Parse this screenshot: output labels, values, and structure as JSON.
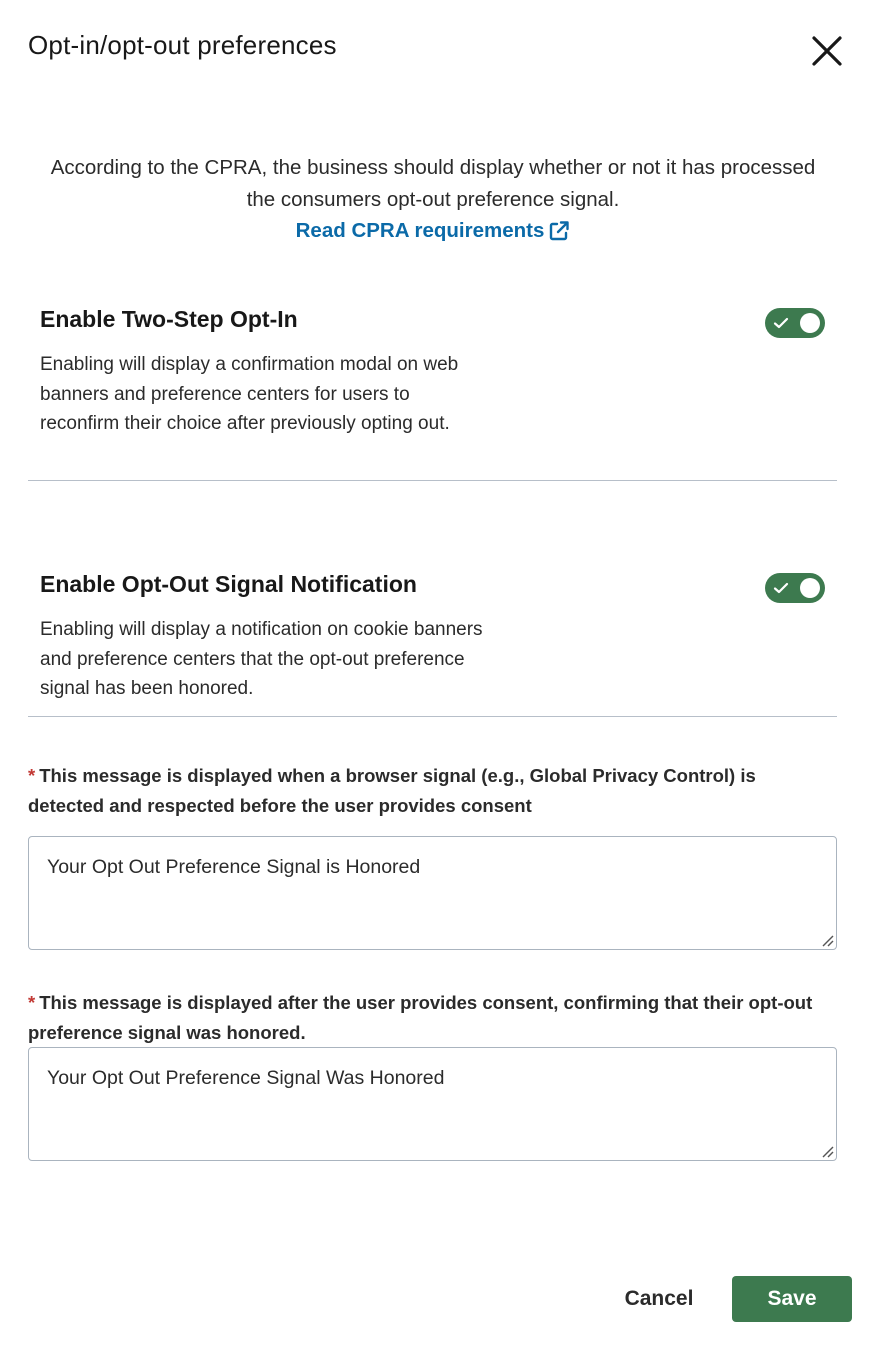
{
  "modal": {
    "title": "Opt-in/opt-out preferences",
    "close_icon": "close-icon"
  },
  "intro": {
    "text": "According to the CPRA, the business should display whether or not it has processed the consumers opt-out preference signal.",
    "link_label": "Read CPRA requirements",
    "link_icon": "external-link-icon",
    "link_color": "#0b6aa8"
  },
  "sections": [
    {
      "title": "Enable Two-Step Opt-In",
      "description": "Enabling will display a confirmation modal on web banners and preference centers for users to reconfirm their choice after previously opting out.",
      "enabled": true
    },
    {
      "title": "Enable Opt-Out Signal Notification",
      "description": "Enabling will display a notification on cookie banners and preference centers that the opt-out preference signal has been honored.",
      "enabled": true
    }
  ],
  "fields": [
    {
      "required_marker": "*",
      "label": "This message is displayed when a browser signal (e.g., Global Privacy Control) is detected and respected before the user provides consent",
      "value": "Your Opt Out Preference Signal is Honored"
    },
    {
      "required_marker": "*",
      "label": "This message is displayed after the user provides consent, confirming that their opt-out preference signal was honored.",
      "value": "Your Opt Out Preference Signal Was Honored"
    }
  ],
  "footer": {
    "cancel_label": "Cancel",
    "save_label": "Save"
  },
  "colors": {
    "accent": "#3d7a4f",
    "required": "#c23934",
    "link": "#0b6aa8"
  }
}
